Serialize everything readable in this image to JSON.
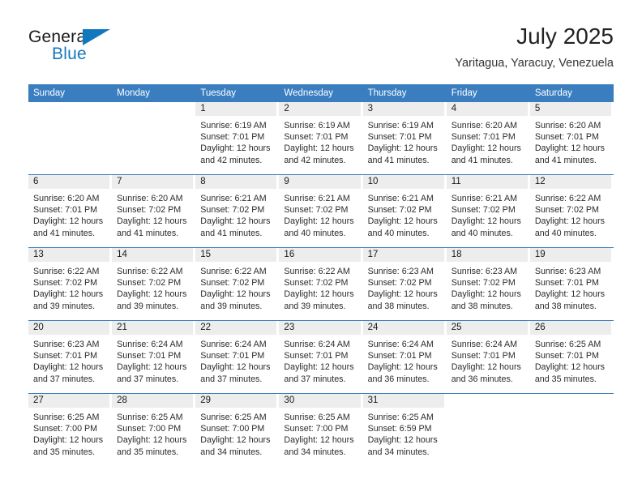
{
  "brand": {
    "word1": "General",
    "word2": "Blue",
    "accent_color": "#1278be",
    "triangle_icon": "brand-triangle-icon"
  },
  "header": {
    "title": "July 2025",
    "subtitle": "Yaritagua, Yaracuy, Venezuela"
  },
  "calendar": {
    "header_bg": "#3a7ebf",
    "daynum_bg": "#ededed",
    "weekday_headers": [
      "Sunday",
      "Monday",
      "Tuesday",
      "Wednesday",
      "Thursday",
      "Friday",
      "Saturday"
    ],
    "weeks": [
      [
        {
          "day": "",
          "blank": true,
          "sunrise": "",
          "sunset": "",
          "daylight1": "",
          "daylight2": ""
        },
        {
          "day": "",
          "blank": true,
          "sunrise": "",
          "sunset": "",
          "daylight1": "",
          "daylight2": ""
        },
        {
          "day": "1",
          "sunrise": "Sunrise: 6:19 AM",
          "sunset": "Sunset: 7:01 PM",
          "daylight1": "Daylight: 12 hours",
          "daylight2": "and 42 minutes."
        },
        {
          "day": "2",
          "sunrise": "Sunrise: 6:19 AM",
          "sunset": "Sunset: 7:01 PM",
          "daylight1": "Daylight: 12 hours",
          "daylight2": "and 42 minutes."
        },
        {
          "day": "3",
          "sunrise": "Sunrise: 6:19 AM",
          "sunset": "Sunset: 7:01 PM",
          "daylight1": "Daylight: 12 hours",
          "daylight2": "and 41 minutes."
        },
        {
          "day": "4",
          "sunrise": "Sunrise: 6:20 AM",
          "sunset": "Sunset: 7:01 PM",
          "daylight1": "Daylight: 12 hours",
          "daylight2": "and 41 minutes."
        },
        {
          "day": "5",
          "sunrise": "Sunrise: 6:20 AM",
          "sunset": "Sunset: 7:01 PM",
          "daylight1": "Daylight: 12 hours",
          "daylight2": "and 41 minutes."
        }
      ],
      [
        {
          "day": "6",
          "sunrise": "Sunrise: 6:20 AM",
          "sunset": "Sunset: 7:01 PM",
          "daylight1": "Daylight: 12 hours",
          "daylight2": "and 41 minutes."
        },
        {
          "day": "7",
          "sunrise": "Sunrise: 6:20 AM",
          "sunset": "Sunset: 7:02 PM",
          "daylight1": "Daylight: 12 hours",
          "daylight2": "and 41 minutes."
        },
        {
          "day": "8",
          "sunrise": "Sunrise: 6:21 AM",
          "sunset": "Sunset: 7:02 PM",
          "daylight1": "Daylight: 12 hours",
          "daylight2": "and 41 minutes."
        },
        {
          "day": "9",
          "sunrise": "Sunrise: 6:21 AM",
          "sunset": "Sunset: 7:02 PM",
          "daylight1": "Daylight: 12 hours",
          "daylight2": "and 40 minutes."
        },
        {
          "day": "10",
          "sunrise": "Sunrise: 6:21 AM",
          "sunset": "Sunset: 7:02 PM",
          "daylight1": "Daylight: 12 hours",
          "daylight2": "and 40 minutes."
        },
        {
          "day": "11",
          "sunrise": "Sunrise: 6:21 AM",
          "sunset": "Sunset: 7:02 PM",
          "daylight1": "Daylight: 12 hours",
          "daylight2": "and 40 minutes."
        },
        {
          "day": "12",
          "sunrise": "Sunrise: 6:22 AM",
          "sunset": "Sunset: 7:02 PM",
          "daylight1": "Daylight: 12 hours",
          "daylight2": "and 40 minutes."
        }
      ],
      [
        {
          "day": "13",
          "sunrise": "Sunrise: 6:22 AM",
          "sunset": "Sunset: 7:02 PM",
          "daylight1": "Daylight: 12 hours",
          "daylight2": "and 39 minutes."
        },
        {
          "day": "14",
          "sunrise": "Sunrise: 6:22 AM",
          "sunset": "Sunset: 7:02 PM",
          "daylight1": "Daylight: 12 hours",
          "daylight2": "and 39 minutes."
        },
        {
          "day": "15",
          "sunrise": "Sunrise: 6:22 AM",
          "sunset": "Sunset: 7:02 PM",
          "daylight1": "Daylight: 12 hours",
          "daylight2": "and 39 minutes."
        },
        {
          "day": "16",
          "sunrise": "Sunrise: 6:22 AM",
          "sunset": "Sunset: 7:02 PM",
          "daylight1": "Daylight: 12 hours",
          "daylight2": "and 39 minutes."
        },
        {
          "day": "17",
          "sunrise": "Sunrise: 6:23 AM",
          "sunset": "Sunset: 7:02 PM",
          "daylight1": "Daylight: 12 hours",
          "daylight2": "and 38 minutes."
        },
        {
          "day": "18",
          "sunrise": "Sunrise: 6:23 AM",
          "sunset": "Sunset: 7:02 PM",
          "daylight1": "Daylight: 12 hours",
          "daylight2": "and 38 minutes."
        },
        {
          "day": "19",
          "sunrise": "Sunrise: 6:23 AM",
          "sunset": "Sunset: 7:01 PM",
          "daylight1": "Daylight: 12 hours",
          "daylight2": "and 38 minutes."
        }
      ],
      [
        {
          "day": "20",
          "sunrise": "Sunrise: 6:23 AM",
          "sunset": "Sunset: 7:01 PM",
          "daylight1": "Daylight: 12 hours",
          "daylight2": "and 37 minutes."
        },
        {
          "day": "21",
          "sunrise": "Sunrise: 6:24 AM",
          "sunset": "Sunset: 7:01 PM",
          "daylight1": "Daylight: 12 hours",
          "daylight2": "and 37 minutes."
        },
        {
          "day": "22",
          "sunrise": "Sunrise: 6:24 AM",
          "sunset": "Sunset: 7:01 PM",
          "daylight1": "Daylight: 12 hours",
          "daylight2": "and 37 minutes."
        },
        {
          "day": "23",
          "sunrise": "Sunrise: 6:24 AM",
          "sunset": "Sunset: 7:01 PM",
          "daylight1": "Daylight: 12 hours",
          "daylight2": "and 37 minutes."
        },
        {
          "day": "24",
          "sunrise": "Sunrise: 6:24 AM",
          "sunset": "Sunset: 7:01 PM",
          "daylight1": "Daylight: 12 hours",
          "daylight2": "and 36 minutes."
        },
        {
          "day": "25",
          "sunrise": "Sunrise: 6:24 AM",
          "sunset": "Sunset: 7:01 PM",
          "daylight1": "Daylight: 12 hours",
          "daylight2": "and 36 minutes."
        },
        {
          "day": "26",
          "sunrise": "Sunrise: 6:25 AM",
          "sunset": "Sunset: 7:01 PM",
          "daylight1": "Daylight: 12 hours",
          "daylight2": "and 35 minutes."
        }
      ],
      [
        {
          "day": "27",
          "sunrise": "Sunrise: 6:25 AM",
          "sunset": "Sunset: 7:00 PM",
          "daylight1": "Daylight: 12 hours",
          "daylight2": "and 35 minutes."
        },
        {
          "day": "28",
          "sunrise": "Sunrise: 6:25 AM",
          "sunset": "Sunset: 7:00 PM",
          "daylight1": "Daylight: 12 hours",
          "daylight2": "and 35 minutes."
        },
        {
          "day": "29",
          "sunrise": "Sunrise: 6:25 AM",
          "sunset": "Sunset: 7:00 PM",
          "daylight1": "Daylight: 12 hours",
          "daylight2": "and 34 minutes."
        },
        {
          "day": "30",
          "sunrise": "Sunrise: 6:25 AM",
          "sunset": "Sunset: 7:00 PM",
          "daylight1": "Daylight: 12 hours",
          "daylight2": "and 34 minutes."
        },
        {
          "day": "31",
          "sunrise": "Sunrise: 6:25 AM",
          "sunset": "Sunset: 6:59 PM",
          "daylight1": "Daylight: 12 hours",
          "daylight2": "and 34 minutes."
        },
        {
          "day": "",
          "blank": true,
          "sunrise": "",
          "sunset": "",
          "daylight1": "",
          "daylight2": ""
        },
        {
          "day": "",
          "blank": true,
          "sunrise": "",
          "sunset": "",
          "daylight1": "",
          "daylight2": ""
        }
      ]
    ]
  }
}
